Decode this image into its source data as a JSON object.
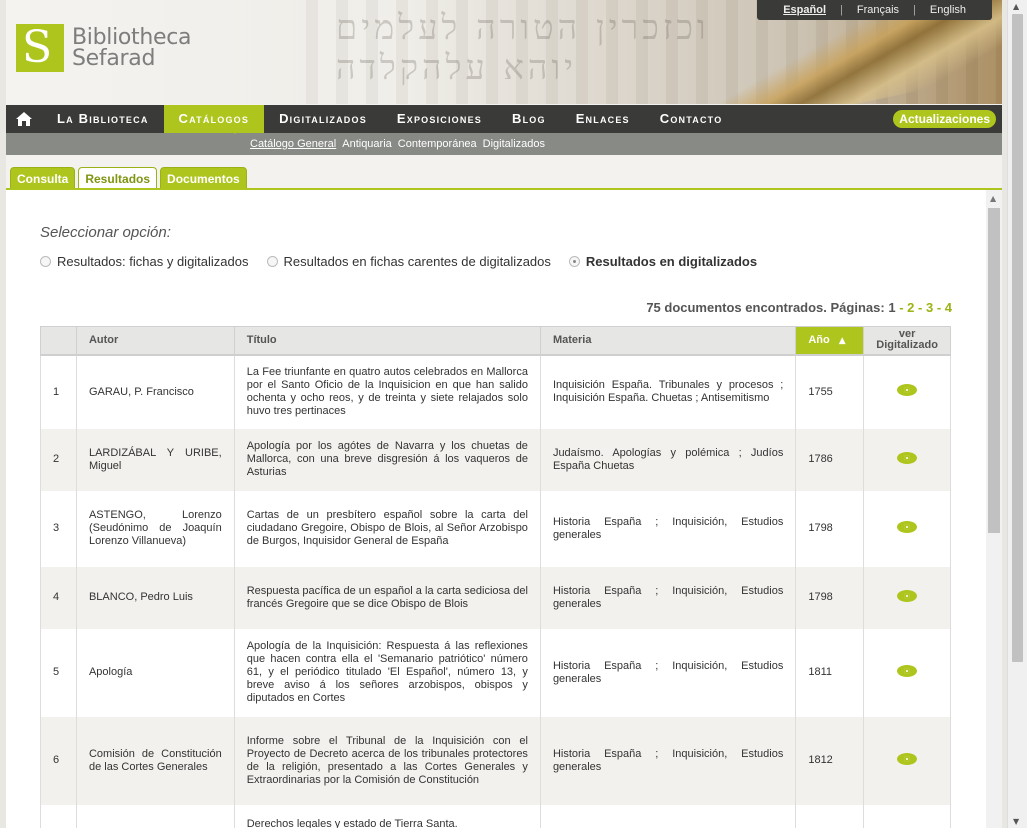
{
  "brand": {
    "line1": "Bibliotheca",
    "line2": "Sefarad"
  },
  "header": {
    "hebrew": "וכזכרין הטורה לעלמים יוהא עלהקלדה"
  },
  "languages": [
    "Español",
    "Français",
    "English"
  ],
  "nav": {
    "items": [
      "La Biblioteca",
      "Catálogos",
      "Digitalizados",
      "Exposiciones",
      "Blog",
      "Enlaces",
      "Contacto"
    ],
    "active": "Catálogos",
    "updates": "Actualizaciones"
  },
  "subnav": [
    "Catálogo General",
    "Antiquaria",
    "Contemporánea",
    "Digitalizados"
  ],
  "tabs": [
    "Consulta",
    "Resultados",
    "Documentos"
  ],
  "options": {
    "title": "Seleccionar opción:",
    "items": [
      "Resultados: fichas y digitalizados",
      "Resultados en fichas carentes de digitalizados",
      "Resultados en digitalizados"
    ],
    "selected": 2
  },
  "results": {
    "summary": "75 documentos encontrados. Páginas:",
    "pages": [
      "1",
      "2",
      "3",
      "4"
    ],
    "current_page": "1"
  },
  "table": {
    "columns": [
      "",
      "Autor",
      "Título",
      "Materia",
      "Año",
      "ver Digitalizado"
    ],
    "rows": [
      {
        "n": "1",
        "autor": "GARAU, P. Francisco",
        "titulo": "La Fee triunfante en quatro autos celebrados en Mallorca por el Santo Oficio de la Inquisicion en que han salido ochenta y ocho reos, y de treinta y siete relajados solo huvo tres pertinaces",
        "materia": "Inquisición España. Tribunales y procesos ; Inquisición España. Chuetas ; Antisemitismo",
        "anio": "1755"
      },
      {
        "n": "2",
        "autor": "LARDIZÁBAL Y URIBE, Miguel",
        "titulo": "Apología por los agótes de Navarra y los chuetas de Mallorca, con una breve disgresión á los vaqueros de Asturias",
        "materia": "Judaísmo. Apologías y polémica ; Judíos España Chuetas",
        "anio": "1786"
      },
      {
        "n": "3",
        "autor": "ASTENGO, Lorenzo (Seudónimo de Joaquín Lorenzo Villanueva)",
        "titulo": "Cartas de un presbítero español sobre la carta del ciudadano Gregoire, Obispo de Blois, al Señor Arzobispo de Burgos, Inquisidor General de España",
        "materia": "Historia España ; Inquisición, Estudios generales",
        "anio": "1798"
      },
      {
        "n": "4",
        "autor": "BLANCO, Pedro Luis",
        "titulo": "Respuesta pacífica de un español a la carta sediciosa del francés Gregoire que se dice Obispo de Blois",
        "materia": "Historia España ; Inquisición, Estudios generales",
        "anio": "1798"
      },
      {
        "n": "5",
        "autor": "Apología",
        "titulo": "Apología de la Inquisición: Respuesta á las reflexiones que hacen contra ella el 'Semanario patriótico' número 61, y el periódico titulado 'El Español', número 13, y breve aviso á los señores arzobispos, obispos y diputados en Cortes",
        "materia": "Historia España ; Inquisición, Estudios generales",
        "anio": "1811"
      },
      {
        "n": "6",
        "autor": "Comisión de Constitución de las Cortes Generales",
        "titulo": "Informe sobre el Tribunal de la Inquisición con el Proyecto de Decreto acerca de los tribunales protectores de la religión, presentado a las Cortes Generales y Extraordinarias por la Comisión de Constitución",
        "materia": "Historia España ; Inquisición, Estudios generales",
        "anio": "1812"
      },
      {
        "n": "",
        "autor": "",
        "titulo": "Derechos legales y estado de Tierra Santa.",
        "materia": "",
        "anio": ""
      }
    ]
  },
  "colors": {
    "accent": "#aec51d",
    "nav_bg": "#3a3a38"
  }
}
